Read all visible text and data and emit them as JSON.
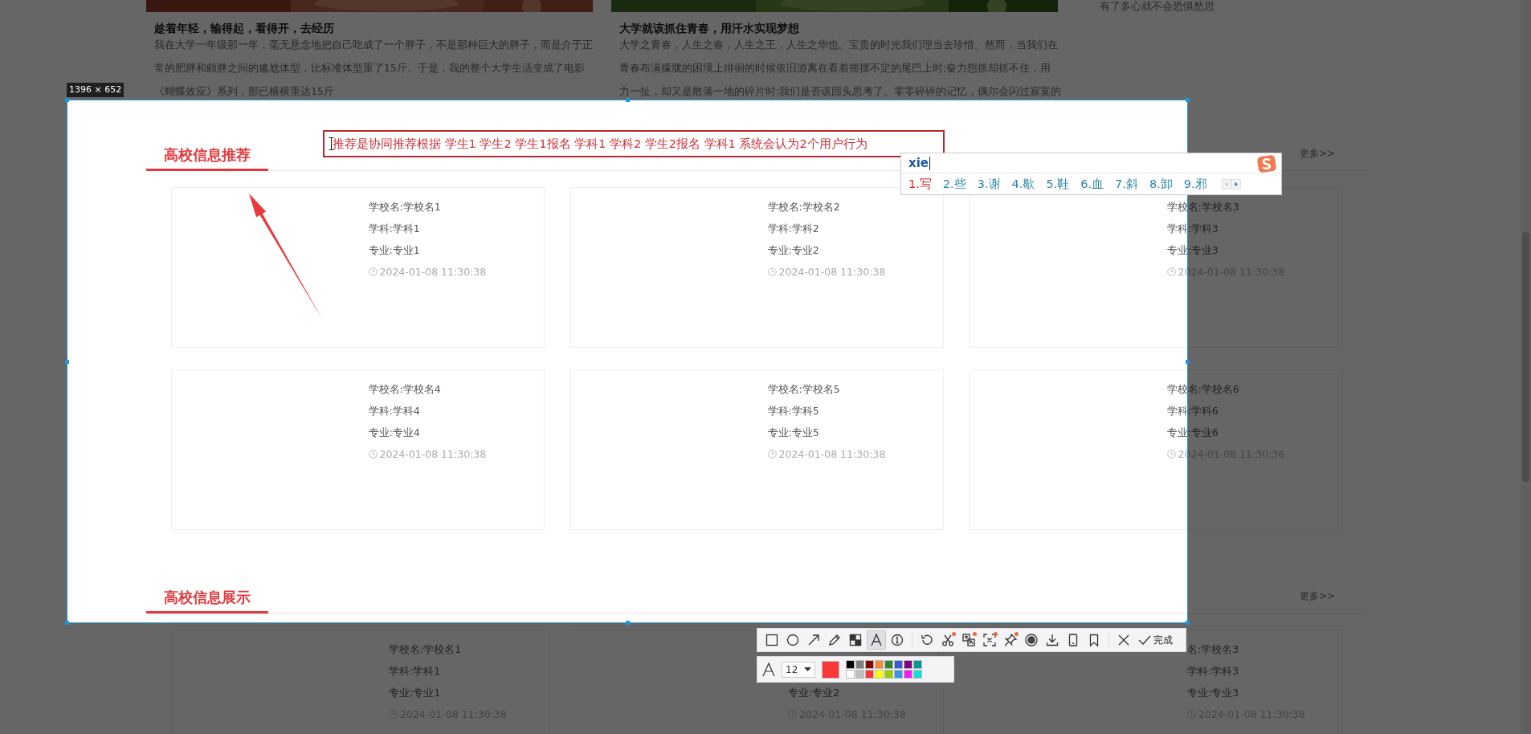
{
  "articles": [
    {
      "title": "趁着年轻，输得起，看得开，去经历",
      "lines": [
        "我在大学一年级那一年，毫无悬念地把自己吃成了一个胖子，不是那种巨大的胖子，而是介于正",
        "常的肥胖和颇胖之间的尴尬体型，比标准体型重了15斤。于是，我的整个大学生活变成了电影",
        "《蝴蝶效应》系列，那已横横重达15斤"
      ]
    },
    {
      "title": "大学就该抓住青春，用汗水实现梦想",
      "lines": [
        "大学之青春，人生之春，人生之王，人生之华也。宝贵的时光我们理当去珍惜。然而，当我们在",
        "青春布满朦胧的困境上徘徊的时候依旧游离在看着摇摆不定的尾巴上时:奋力想抓却抓不住，用",
        "力一扯，却又是散落一地的碎片时:我们是否该回头思考了。零零碎碎的记忆，偶尔会闪过寂寞的"
      ]
    }
  ],
  "side_text": "有了多心就不会恐惧愁思",
  "sections": [
    {
      "title": "高校信息推荐",
      "more": "更多>>",
      "cards": [
        {
          "lines": [
            {
              "kind": "school",
              "text": "学校名:学校名1"
            },
            {
              "kind": "subject",
              "text": "学科:学科1"
            },
            {
              "kind": "major",
              "text": "专业:专业1"
            },
            {
              "kind": "time",
              "text": "2024-01-08 11:30:38"
            }
          ]
        },
        {
          "lines": [
            {
              "kind": "school",
              "text": "学校名:学校名2"
            },
            {
              "kind": "subject",
              "text": "学科:学科2"
            },
            {
              "kind": "major",
              "text": "专业:专业2"
            },
            {
              "kind": "time",
              "text": "2024-01-08 11:30:38"
            }
          ]
        },
        {
          "lines": [
            {
              "kind": "school",
              "text": "学校名:学校名3"
            },
            {
              "kind": "subject",
              "text": "学科:学科3"
            },
            {
              "kind": "major",
              "text": "专业:专业3"
            },
            {
              "kind": "time",
              "text": "2024-01-08 11:30:38"
            }
          ]
        },
        {
          "lines": [
            {
              "kind": "school",
              "text": "学校名:学校名4"
            },
            {
              "kind": "subject",
              "text": "学科:学科4"
            },
            {
              "kind": "major",
              "text": "专业:专业4"
            },
            {
              "kind": "time",
              "text": "2024-01-08 11:30:38"
            }
          ]
        },
        {
          "lines": [
            {
              "kind": "school",
              "text": "学校名:学校名5"
            },
            {
              "kind": "subject",
              "text": "学科:学科5"
            },
            {
              "kind": "major",
              "text": "专业:专业5"
            },
            {
              "kind": "time",
              "text": "2024-01-08 11:30:38"
            }
          ]
        },
        {
          "lines": [
            {
              "kind": "school",
              "text": "学校名:学校名6"
            },
            {
              "kind": "subject",
              "text": "学科:学科6"
            },
            {
              "kind": "major",
              "text": "专业:专业6"
            },
            {
              "kind": "time",
              "text": "2024-01-08 11:30:36"
            }
          ]
        }
      ]
    },
    {
      "title": "高校信息展示",
      "more": "更多>>",
      "cards": [
        {
          "lines": [
            {
              "kind": "school",
              "text": "学校名:学校名1"
            },
            {
              "kind": "subject",
              "text": "学科:学科1"
            },
            {
              "kind": "major",
              "text": "专业:专业1"
            },
            {
              "kind": "time",
              "text": "2024-01-08 11:30:38"
            }
          ]
        },
        {
          "lines": [
            {
              "kind": "major",
              "text": "专业:专业2"
            },
            {
              "kind": "time",
              "text": "2024-01-08 11:30:38"
            }
          ]
        },
        {
          "lines": [
            {
              "kind": "school",
              "text": "名:学校名3"
            },
            {
              "kind": "subject",
              "text": "学科:学科3"
            },
            {
              "kind": "major",
              "text": "专业:专业3"
            },
            {
              "kind": "time",
              "text": "2024-01-08 11:30:38"
            }
          ]
        }
      ]
    }
  ],
  "selection": {
    "size": "1396 × 652"
  },
  "annotation": {
    "text": "推荐是协同推荐根据 学生1 学生2 学生1报名 学科1 学科2 学生2报名 学科1  系统会认为2个用户行为"
  },
  "ime": {
    "input": "xie",
    "candidates": [
      {
        "label": "1.写",
        "selected": true
      },
      {
        "label": "2.些",
        "selected": false
      },
      {
        "label": "3.谢",
        "selected": false
      },
      {
        "label": "4.歇",
        "selected": false
      },
      {
        "label": "5.鞋",
        "selected": false
      },
      {
        "label": "6.血",
        "selected": false
      },
      {
        "label": "7.斜",
        "selected": false
      },
      {
        "label": "8.卸",
        "selected": false
      },
      {
        "label": "9.邪",
        "selected": false
      }
    ]
  },
  "toolbar": {
    "tool_groups": [
      [
        {
          "kind": "rect",
          "selected": false,
          "badge": false
        },
        {
          "kind": "ellipse",
          "selected": false,
          "badge": false
        },
        {
          "kind": "arrow",
          "selected": false,
          "badge": false
        },
        {
          "kind": "pencil",
          "selected": false,
          "badge": false
        },
        {
          "kind": "mosaic",
          "selected": false,
          "badge": false
        },
        {
          "kind": "text",
          "selected": true,
          "badge": false
        },
        {
          "kind": "number",
          "selected": false,
          "badge": false
        }
      ],
      [
        {
          "kind": "undo",
          "selected": false,
          "badge": false
        },
        {
          "kind": "cut",
          "selected": false,
          "badge": true
        },
        {
          "kind": "translate",
          "selected": false,
          "badge": true
        },
        {
          "kind": "ocr",
          "selected": false,
          "badge": true
        },
        {
          "kind": "pin",
          "selected": false,
          "badge": true
        },
        {
          "kind": "record",
          "selected": false,
          "badge": false
        },
        {
          "kind": "download",
          "selected": false,
          "badge": false
        },
        {
          "kind": "phone",
          "selected": false,
          "badge": false
        },
        {
          "kind": "bookmark",
          "selected": false,
          "badge": false
        }
      ],
      [
        {
          "kind": "close",
          "selected": false,
          "badge": false
        },
        {
          "kind": "done",
          "label": "完成",
          "selected": false,
          "badge": false
        }
      ]
    ]
  },
  "text_options": {
    "font_size": "12",
    "palette": [
      {
        "color": "#000000",
        "selected": false
      },
      {
        "color": "#808080",
        "selected": false
      },
      {
        "color": "#800000",
        "selected": false
      },
      {
        "color": "#f7883a",
        "selected": false
      },
      {
        "color": "#308430",
        "selected": false
      },
      {
        "color": "#385ad3",
        "selected": false
      },
      {
        "color": "#800080",
        "selected": false
      },
      {
        "color": "#009999",
        "selected": false
      },
      {
        "color": "#ffffff",
        "selected": false
      },
      {
        "color": "#c0c0c0",
        "selected": false
      },
      {
        "color": "#fb3838",
        "selected": true
      },
      {
        "color": "#ffff00",
        "selected": false
      },
      {
        "color": "#99cc00",
        "selected": false
      },
      {
        "color": "#3894e4",
        "selected": false
      },
      {
        "color": "#f31bf3",
        "selected": false
      },
      {
        "color": "#16dcdc",
        "selected": false
      }
    ]
  }
}
